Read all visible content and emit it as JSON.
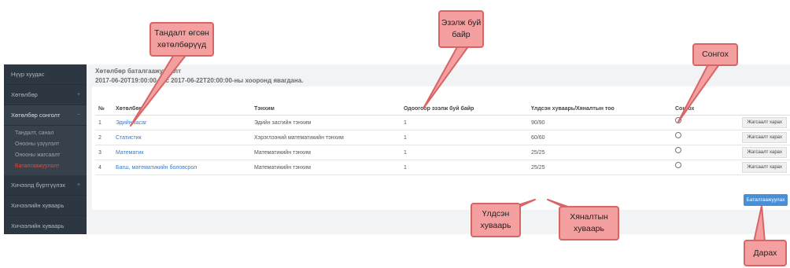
{
  "sidebar": {
    "items": [
      {
        "label": "Нүүр хуудас",
        "chev": ""
      },
      {
        "label": "Хөтөлбөр",
        "chev": "+"
      },
      {
        "label": "Хөтөлбөр сонголт",
        "chev": "−"
      }
    ],
    "subitems": [
      {
        "label": "Тандалт, санал"
      },
      {
        "label": "Онооны үзүүлэлт"
      },
      {
        "label": "Онооны жагсаалт"
      },
      {
        "label": "Баталгаажуулалт"
      }
    ],
    "bottom_items": [
      {
        "label": "Хичээлд бүртгүүлэх",
        "chev": "+"
      },
      {
        "label": "Хичээлийн хуваарь",
        "chev": ""
      },
      {
        "label": "Хичээлийн хуваарь",
        "chev": ""
      }
    ]
  },
  "heading": {
    "line1": "Хөтөлбөр баталгаажуулалт",
    "line2": "2017-06-20T19:00:00-аас 2017-06-22T20:00:00-ны хооронд явагдана."
  },
  "table": {
    "headers": [
      "№",
      "Хөтөлбөр",
      "Тэнхим",
      "Одоогоор эзэлж буй байр",
      "Үлдсэн хуваарь/Хяналтын тоо",
      "Сонгох"
    ],
    "rows": [
      {
        "no": "1",
        "program": "Эдийн засаг",
        "dept": "Эдийн засгийн тэнхим",
        "place": "1",
        "quota": "90/90",
        "action": "Жагсаалт харах"
      },
      {
        "no": "2",
        "program": "Статистик",
        "dept": "Хэрэглээний математикийн тэнхим",
        "place": "1",
        "quota": "60/60",
        "action": "Жагсаалт харах"
      },
      {
        "no": "3",
        "program": "Математик",
        "dept": "Математикийн тэнхим",
        "place": "1",
        "quota": "25/25",
        "action": "Жагсаалт харах"
      },
      {
        "no": "4",
        "program": "Багш, математикийн боловсрол",
        "dept": "Математикийн тэнхим",
        "place": "1",
        "quota": "25/25",
        "action": "Жагсаалт харах"
      }
    ]
  },
  "confirm_button": "Баталгаажуулах",
  "callouts": {
    "selected_programs": "Тандалт өгсөн хөтөлбөрүүд",
    "current_place": "Эзэлж буй байр",
    "choose": "Сонгох",
    "remaining": "Үлдсэн хуваарь",
    "control": "Хяналтын хуваарь",
    "click": "Дарах"
  },
  "colors": {
    "sidebar_bg": "#2d3741",
    "active_item": "#e8473a",
    "callout_fill": "#f5a0a0",
    "link": "#3a7bc8",
    "button": "#4a8fd6"
  }
}
